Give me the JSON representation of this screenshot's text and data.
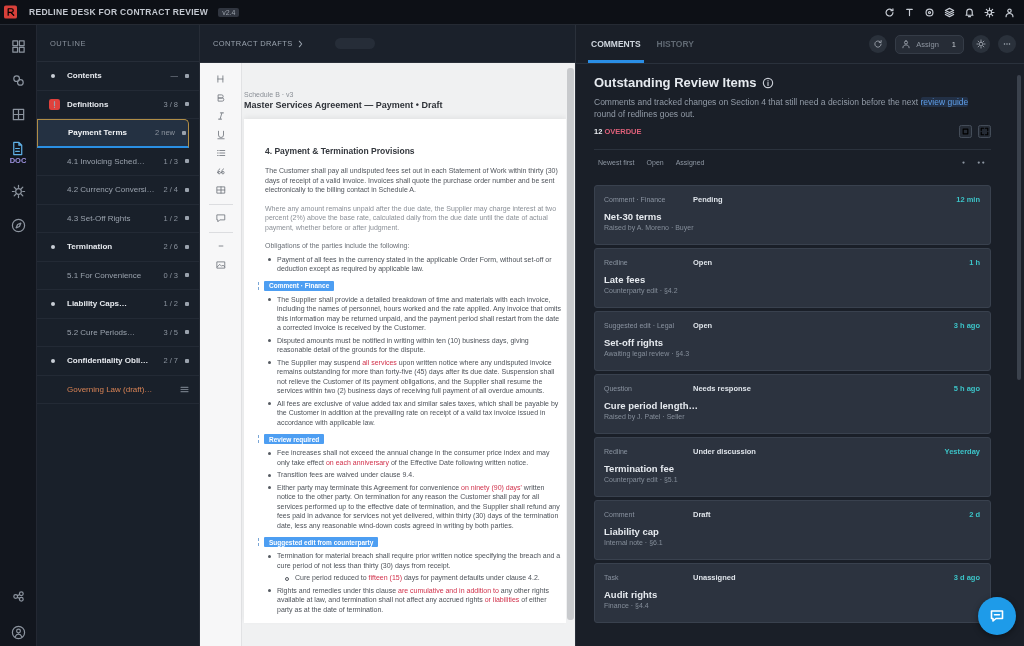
{
  "window": {
    "title": "REDLINE DESK FOR CONTRACT REVIEW",
    "badge": "v2.4"
  },
  "rail": {
    "items": [
      {
        "selected": false
      },
      {
        "selected": false
      },
      {
        "selected": false
      },
      {
        "selected": true,
        "label": "DOC"
      },
      {
        "selected": false
      },
      {
        "selected": false
      }
    ]
  },
  "outline": {
    "title": "OUTLINE",
    "items": [
      {
        "label": "Contents",
        "kind": "section",
        "count": "—",
        "selected": false
      },
      {
        "label": "Definitions",
        "kind": "flagged",
        "count": "3 / 8",
        "selected": false
      },
      {
        "label": "Payment Terms",
        "kind": "clause",
        "count": "2 new",
        "selected": true
      },
      {
        "label": "4.1 Invoicing Sched…",
        "kind": "clause",
        "count": "1 / 3",
        "selected": false
      },
      {
        "label": "4.2 Currency Conversi…",
        "kind": "clause",
        "count": "2 / 4",
        "selected": false
      },
      {
        "label": "4.3 Set-Off Rights",
        "kind": "clause",
        "count": "1 / 2",
        "selected": false
      },
      {
        "label": "Termination",
        "kind": "section",
        "count": "2 / 6",
        "selected": false
      },
      {
        "label": "5.1 For Convenience",
        "kind": "clause",
        "count": "0 / 3",
        "selected": false
      },
      {
        "label": "Liability Caps…",
        "kind": "section",
        "count": "1 / 2",
        "selected": false
      },
      {
        "label": "5.2 Cure Periods…",
        "kind": "clause",
        "count": "3 / 5",
        "selected": false
      },
      {
        "label": "Confidentiality Obli…",
        "kind": "section",
        "count": "2 / 7",
        "selected": false
      },
      {
        "label": "Governing Law (draft)…",
        "kind": "note",
        "selected": false
      }
    ]
  },
  "document": {
    "breadcrumb": "CONTRACT DRAFTS",
    "kicker": "Schedule B · v3",
    "title": "Master Services Agreement — Payment • Draft",
    "blocks": [
      {
        "kind": "heading",
        "text": "4. Payment & Termination Provisions"
      },
      {
        "kind": "paragraph",
        "segments": [
          {
            "kind": "plain",
            "text": "The Customer shall pay all undisputed fees set out in each Statement of Work within thirty (30) days of receipt of a valid invoice. Invoices shall quote the purchase order number and be sent electronically to the billing contact in Schedule A."
          }
        ]
      },
      {
        "kind": "muted",
        "segments": [
          {
            "kind": "plain",
            "text": "Where any amount remains unpaid after the due date, the Supplier may charge interest at two percent (2%) above the base rate, calculated daily from the due date until the date of actual payment, whether before or after judgment."
          }
        ]
      },
      {
        "kind": "subheading",
        "text": "Obligations of the parties include the following:"
      },
      {
        "kind": "bullet",
        "segments": [
          {
            "kind": "plain",
            "text": "Payment of all fees in the currency stated in the applicable Order Form, without set-off or deduction except as required by applicable law."
          }
        ]
      },
      {
        "kind": "tag",
        "text": "Comment · Finance"
      },
      {
        "kind": "bullet",
        "segments": [
          {
            "kind": "plain",
            "text": "The Supplier shall provide a detailed breakdown of time and materials with each invoice, including the names of personnel, hours worked and the rate applied. Any invoice that omits this information may be returned unpaid, and the payment period shall restart from the date a corrected invoice is received by the Customer."
          }
        ]
      },
      {
        "kind": "bullet",
        "segments": [
          {
            "kind": "plain",
            "text": "Disputed amounts must be notified in writing within ten (10) business days, giving reasonable detail of the grounds for the dispute."
          }
        ]
      },
      {
        "kind": "bullet",
        "segments": [
          {
            "kind": "plain",
            "text": "The Supplier may suspend "
          },
          {
            "kind": "change",
            "text": "all services"
          },
          {
            "kind": "plain",
            "text": " upon written notice where any undisputed invoice remains outstanding for more than forty-five (45) days after its due date. Suspension shall not relieve the Customer of its payment obligations, and the Supplier shall resume the services within two (2) business days of receiving full payment of all overdue amounts."
          }
        ]
      },
      {
        "kind": "bullet",
        "segments": [
          {
            "kind": "plain",
            "text": "All fees are exclusive of value added tax and similar sales taxes, which shall be payable by the Customer in addition at the prevailing rate on receipt of a valid tax invoice issued in accordance with applicable law."
          }
        ]
      },
      {
        "kind": "tag",
        "text": "Review required"
      },
      {
        "kind": "bullet",
        "segments": [
          {
            "kind": "plain",
            "text": "Fee increases shall not exceed the annual change in the consumer price index and may only take effect "
          },
          {
            "kind": "change",
            "text": "on each anniversary"
          },
          {
            "kind": "plain",
            "text": " of the Effective Date following written notice."
          }
        ]
      },
      {
        "kind": "bullet",
        "segments": [
          {
            "kind": "plain",
            "text": "Transition fees are waived under clause 9.4."
          }
        ]
      },
      {
        "kind": "bullet",
        "segments": [
          {
            "kind": "plain",
            "text": "Either party may terminate this Agreement for convenience "
          },
          {
            "kind": "change",
            "text": "on ninety (90) days'"
          },
          {
            "kind": "plain",
            "text": " written notice to the other party. On termination for any reason the Customer shall pay for all services performed up to the effective date of termination, and the Supplier shall refund any fees paid in advance for services not yet delivered, within thirty (30) days of the termination date, less any reasonable wind-down costs agreed in writing by both parties."
          }
        ]
      },
      {
        "kind": "tag",
        "text": "Suggested edit from counterparty"
      },
      {
        "kind": "bullet",
        "segments": [
          {
            "kind": "plain",
            "text": "Termination for material breach shall require prior written notice specifying the breach and a cure period of not less than thirty (30) days from receipt."
          }
        ]
      },
      {
        "kind": "subbullet",
        "segments": [
          {
            "kind": "plain",
            "text": "Cure period reduced to "
          },
          {
            "kind": "change",
            "text": "fifteen (15)"
          },
          {
            "kind": "plain",
            "text": " days for payment defaults under clause 4.2."
          }
        ]
      },
      {
        "kind": "bullet",
        "segments": [
          {
            "kind": "plain",
            "text": "Rights and remedies under this clause "
          },
          {
            "kind": "change",
            "text": "are cumulative and in addition to"
          },
          {
            "kind": "plain",
            "text": " any other rights available at law, and termination shall not affect any accrued rights "
          },
          {
            "kind": "change",
            "text": "or liabilities"
          },
          {
            "kind": "plain",
            "text": " of either party as at the date of termination."
          }
        ]
      }
    ]
  },
  "comments": {
    "tabs": [
      {
        "label": "COMMENTS",
        "selected": true
      },
      {
        "label": "HISTORY",
        "selected": false
      }
    ],
    "assign": {
      "label": "Assign",
      "count": "1"
    },
    "heading": "Outstanding Review Items",
    "description": {
      "before": "Comments and tracked changes on Section 4 that still need a decision before the next ",
      "link": "review guide",
      "after": " round of redlines goes out."
    },
    "summary": {
      "count": "12",
      "label": "OVERDUE"
    },
    "filters": [
      "Newest first",
      "Open",
      "Assigned"
    ],
    "cards": [
      {
        "type": "Comment · Finance",
        "status": "Pending",
        "time": "12 min",
        "title": "Net-30 terms",
        "subtitle": "Raised by A. Moreno · Buyer"
      },
      {
        "type": "Redline",
        "status": "Open",
        "time": "1 h",
        "title": "Late fees",
        "subtitle": "Counterparty edit · §4.2"
      },
      {
        "type": "Suggested edit · Legal",
        "status": "Open",
        "time": "3 h ago",
        "title": "Set-off rights",
        "subtitle": "Awaiting legal review · §4.3"
      },
      {
        "type": "Question",
        "status": "Needs response",
        "time": "5 h ago",
        "title": "Cure period length…",
        "subtitle": "Raised by J. Patel · Seller"
      },
      {
        "type": "Redline",
        "status": "Under discussion",
        "time": "Yesterday",
        "title": "Termination fee",
        "subtitle": "Counterparty edit · §5.1"
      },
      {
        "type": "Comment",
        "status": "Draft",
        "time": "2 d",
        "title": "Liability cap",
        "subtitle": "Internal note · §6.1"
      },
      {
        "type": "Task",
        "status": "Unassigned",
        "time": "3 d ago",
        "title": "Audit rights",
        "subtitle": "Finance · §4.4"
      }
    ]
  }
}
